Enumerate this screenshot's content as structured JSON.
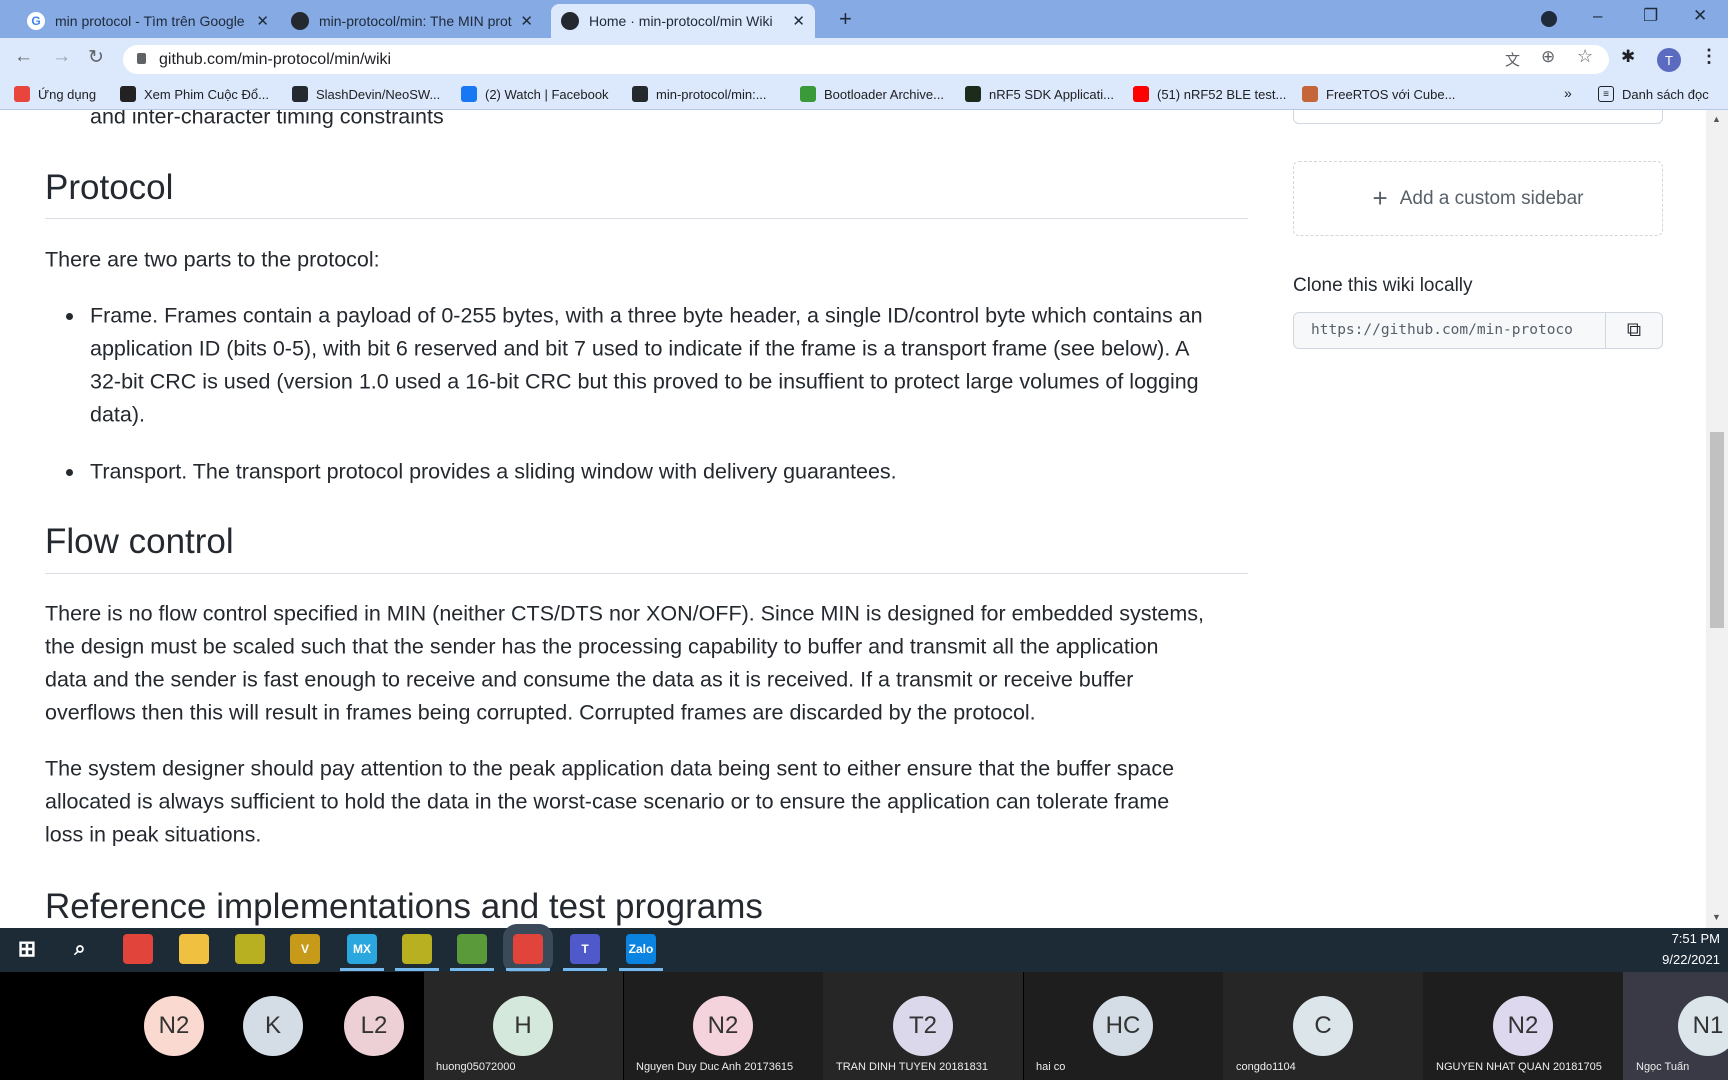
{
  "browser": {
    "tabs": [
      {
        "title": "min protocol - Tìm trên Google",
        "icon": "google-icon",
        "active": false
      },
      {
        "title": "min-protocol/min: The MIN proto",
        "icon": "github-icon",
        "active": false
      },
      {
        "title": "Home · min-protocol/min Wiki",
        "icon": "github-icon",
        "active": true
      }
    ],
    "new_tab": "+",
    "url": "github.com/min-protocol/min/wiki",
    "profile_initial": "T",
    "bookmarks": [
      {
        "label": "Ứng dụng",
        "icon": "apps-icon",
        "color": "#e8453c"
      },
      {
        "label": "Xem Phim Cuộc Đổ...",
        "icon": "tv-icon",
        "color": "#222222"
      },
      {
        "label": "SlashDevin/NeoSW...",
        "icon": "github-icon",
        "color": "#24292f"
      },
      {
        "label": "(2) Watch | Facebook",
        "icon": "facebook-icon",
        "color": "#1877f2"
      },
      {
        "label": "min-protocol/min:...",
        "icon": "github-icon",
        "color": "#24292f"
      },
      {
        "label": "Bootloader Archive...",
        "icon": "leaf-icon",
        "color": "#3a9a3a"
      },
      {
        "label": "nRF5 SDK Applicati...",
        "icon": "brace-icon",
        "color": "#1d2b1d"
      },
      {
        "label": "(51) nRF52 BLE test...",
        "icon": "youtube-icon",
        "color": "#ff0000"
      },
      {
        "label": "FreeRTOS với Cube...",
        "icon": "freertos-icon",
        "color": "#c4663a"
      }
    ],
    "more": "»",
    "reading_list": "Danh sách đọc"
  },
  "page": {
    "top_cut": "and inter-character timing constraints",
    "protocol_heading": "Protocol",
    "intro": "There are two parts to the protocol:",
    "frame_lines": [
      "Frame. Frames contain a payload of 0-255 bytes, with a three byte header, a single ID/control byte which contains an",
      "application ID (bits 0-5), with bit 6 reserved and bit 7 used to indicate if the frame is a transport frame (see below). A",
      "32-bit CRC is used (version 1.0 used a 16-bit CRC but this proved to be insuffient to protect large volumes of logging",
      "data)."
    ],
    "transport": "Transport. The transport protocol provides a sliding window with delivery guarantees.",
    "flow_heading": "Flow control",
    "flow_p1": [
      "There is no flow control specified in MIN (neither CTS/DTS nor XON/OFF). Since MIN is designed for embedded systems,",
      "the design must be scaled such that the sender has the processing capability to buffer and transmit all the application",
      "data and the sender is fast enough to receive and consume the data as it is received. If a transmit or receive buffer",
      "overflows then this will result in frames being corrupted. Corrupted frames are discarded by the protocol."
    ],
    "flow_p2": [
      "The system designer should pay attention to the peak application data being sent to either ensure that the buffer space",
      "allocated is always sufficient to hold the data in the worst-case scenario or to ensure the application can tolerate frame",
      "loss in peak situations."
    ],
    "ref_heading": "Reference implementations and test programs"
  },
  "sidebar": {
    "add_custom": "Add a custom sidebar",
    "clone_heading": "Clone this wiki locally",
    "clone_url": "https://github.com/min-protocol/min.wiki.git",
    "clone_url_visible": "https://github.com/min-protoco"
  },
  "taskbar": {
    "icons": [
      {
        "name": "windows-start-icon",
        "label": "",
        "color": "transparent"
      },
      {
        "name": "search-icon",
        "label": "",
        "color": "transparent"
      },
      {
        "name": "chrome-icon",
        "label": "",
        "color": "#e0443a"
      },
      {
        "name": "file-explorer-icon",
        "label": "",
        "color": "#f0c040"
      },
      {
        "name": "tool-icon",
        "label": "",
        "color": "#b8b020"
      },
      {
        "name": "v-app-icon",
        "label": "V",
        "color": "#c79a1a"
      },
      {
        "name": "mx-icon",
        "label": "MX",
        "color": "#2aa7df"
      },
      {
        "name": "tool2-icon",
        "label": "",
        "color": "#b8b020"
      },
      {
        "name": "notepad-icon",
        "label": "",
        "color": "#5a9a3a"
      },
      {
        "name": "chrome-profile-icon",
        "label": "",
        "color": "#e0443a"
      },
      {
        "name": "teams-icon",
        "label": "T",
        "color": "#5059c9"
      },
      {
        "name": "zalo-icon",
        "label": "Zalo",
        "color": "#0a84e0"
      }
    ],
    "time": "7:51 PM",
    "date": "9/22/2021"
  },
  "meeting": {
    "participants": [
      {
        "initials": "N2",
        "name": "",
        "color": "#f9d9d0"
      },
      {
        "initials": "K",
        "name": "",
        "color": "#d4dde5"
      },
      {
        "initials": "L2",
        "name": "",
        "color": "#ecd0d5"
      },
      {
        "initials": "H",
        "name": "huong05072000",
        "color": "#d5e8dc"
      },
      {
        "initials": "N2",
        "name": "Nguyen Duy Duc Anh 20173615",
        "color": "#f5d3dc"
      },
      {
        "initials": "T2",
        "name": "TRAN DINH TUYEN 20181831",
        "color": "#dcd8ec"
      },
      {
        "initials": "HC",
        "name": "hai co",
        "color": "#d4dde5"
      },
      {
        "initials": "C",
        "name": "congdo1104",
        "color": "#dbe5ea"
      },
      {
        "initials": "N2",
        "name": "NGUYEN NHAT QUAN 20181705",
        "color": "#ddd8ee"
      },
      {
        "initials": "N1",
        "name": "Ngọc Tuấn",
        "color": "#dbe5ea"
      }
    ]
  }
}
